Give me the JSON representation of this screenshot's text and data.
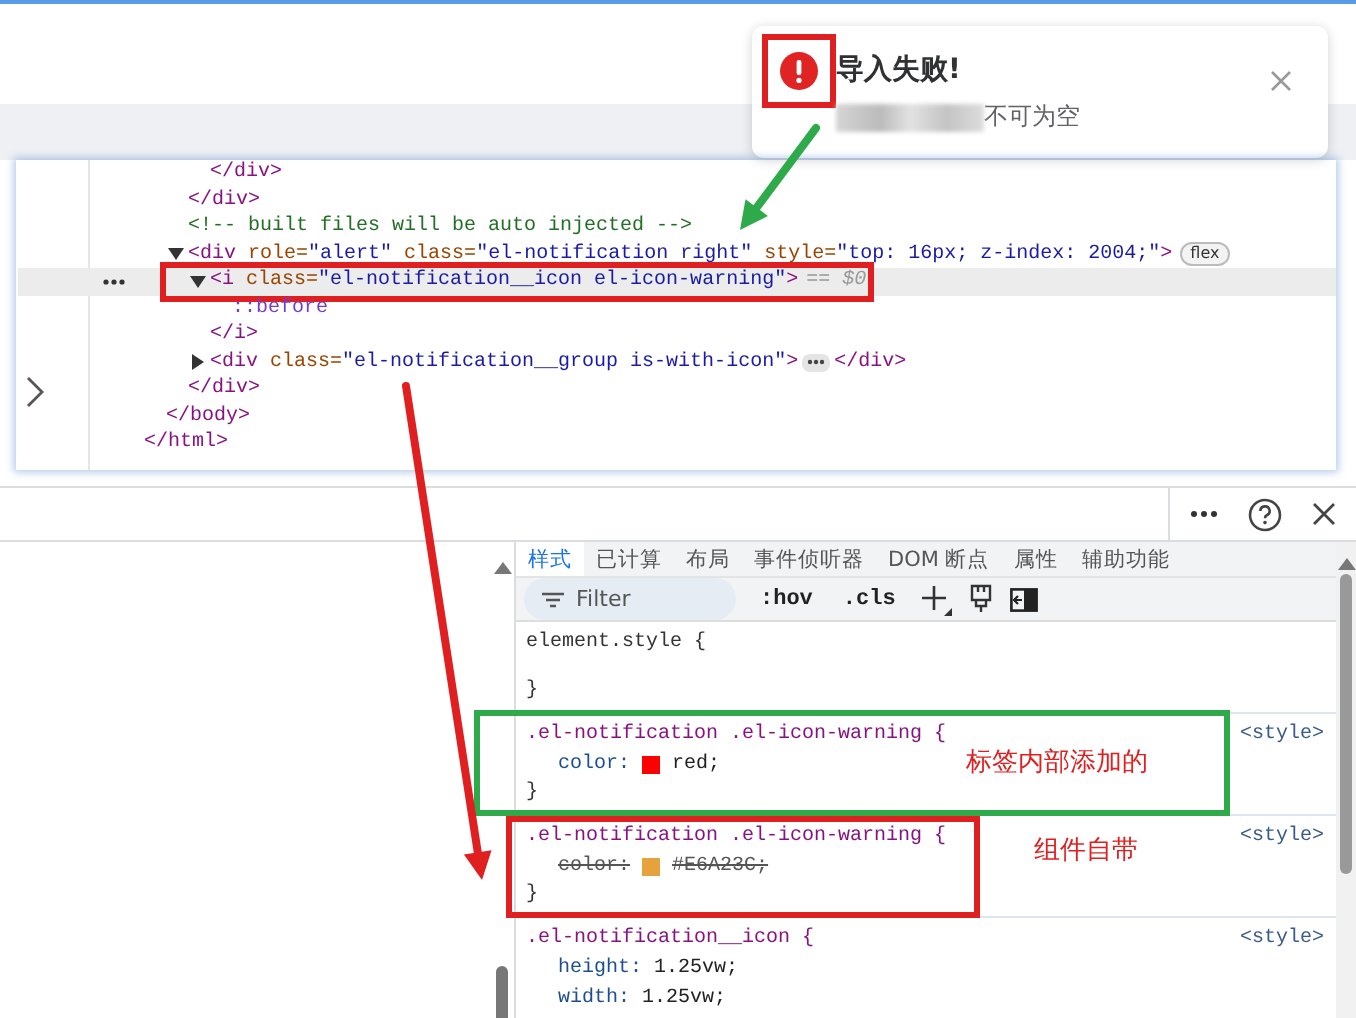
{
  "notification": {
    "title": "导入失败!",
    "message": "不可为空"
  },
  "dom_tree": [
    {
      "selected": false,
      "close": "</html>",
      "children": [
        {
          "selected": false,
          "close": "</body>",
          "children": [
            {
              "selected": false,
              "close": "</div>",
              "children": [
                {
                  "selected": false,
                  "close": "</div>"
                }
              ]
            },
            {
              "selected": false,
              "kind": "comment",
              "text": "<!-- built files will be auto injected -->"
            },
            {
              "selected": false,
              "expanded": true,
              "badge": "flex",
              "close": "</div>",
              "open": [
                {
                  "kind": "tag",
                  "text": "<div"
                },
                {
                  "kind": "attr",
                  "text": " role="
                },
                {
                  "kind": "value",
                  "text": "\"alert\""
                },
                {
                  "kind": "attr",
                  "text": " class="
                },
                {
                  "kind": "value",
                  "text": "\"el-notification right\""
                },
                {
                  "kind": "attr",
                  "text": " style="
                },
                {
                  "kind": "value",
                  "text": "\"top: 16px; z-index: 2004;\""
                },
                {
                  "kind": "tag",
                  "text": ">"
                }
              ],
              "children": [
                {
                  "selected": true,
                  "expanded": true,
                  "hint": "== $0",
                  "close": "</i>",
                  "open": [
                    {
                      "kind": "tag",
                      "text": "<i"
                    },
                    {
                      "kind": "attr",
                      "text": " class="
                    },
                    {
                      "kind": "value",
                      "text": "\"el-notification__icon el-icon-warning\""
                    },
                    {
                      "kind": "tag",
                      "text": ">"
                    }
                  ],
                  "children": [
                    {
                      "selected": false,
                      "kind": "pseudo",
                      "text": "::before"
                    }
                  ]
                },
                {
                  "selected": false,
                  "expanded": false,
                  "close": "</div>",
                  "open": [
                    {
                      "kind": "tag",
                      "text": "<div"
                    },
                    {
                      "kind": "attr",
                      "text": " class="
                    },
                    {
                      "kind": "value",
                      "text": "\"el-notification__group is-with-icon\""
                    },
                    {
                      "kind": "tag",
                      "text": ">"
                    }
                  ]
                }
              ]
            }
          ]
        }
      ]
    }
  ],
  "styles": {
    "tabs": [
      {
        "label": "样式",
        "selected": true
      },
      {
        "label": "已计算",
        "selected": false
      },
      {
        "label": "布局",
        "selected": false
      },
      {
        "label": "事件侦听器",
        "selected": false
      },
      {
        "label": "DOM 断点",
        "selected": false
      },
      {
        "label": "属性",
        "selected": false
      },
      {
        "label": "辅助功能",
        "selected": false
      }
    ],
    "filter": {
      "placeholder": "Filter"
    },
    "toggles": [
      ":hov",
      ".cls"
    ],
    "rules": [
      {
        "selector": "element.style {",
        "close": "}"
      },
      {
        "selector": ".el-notification .el-icon-warning {",
        "source": "<style>",
        "close": "}",
        "declarations": [
          {
            "property": "color:",
            "value": "red;",
            "color": "#ff0000",
            "overridden": false
          }
        ]
      },
      {
        "selector": ".el-notification .el-icon-warning {",
        "source": "<style>",
        "close": "}",
        "declarations": [
          {
            "property": "color:",
            "value": "#E6A23C;",
            "color": "#e6a23c",
            "overridden": true
          }
        ]
      },
      {
        "selector": ".el-notification__icon {",
        "source": "<style>",
        "declarations": [
          {
            "property": "height:",
            "value": "1.25vw;",
            "overridden": false
          },
          {
            "property": "width:",
            "value": "1.25vw;",
            "overridden": false
          }
        ]
      }
    ]
  },
  "annotations": {
    "boxes": [
      {
        "color": "#e02020"
      },
      {
        "color": "#e02020"
      },
      {
        "color": "#2eaa4a"
      },
      {
        "color": "#e02020"
      }
    ],
    "arrows": [
      {
        "color": "#2eaa4a"
      },
      {
        "color": "#e02020"
      }
    ],
    "notes": [
      {
        "text": "标签内部添加的",
        "color": "#e02020"
      },
      {
        "text": "组件自带",
        "color": "#e02020"
      }
    ]
  }
}
